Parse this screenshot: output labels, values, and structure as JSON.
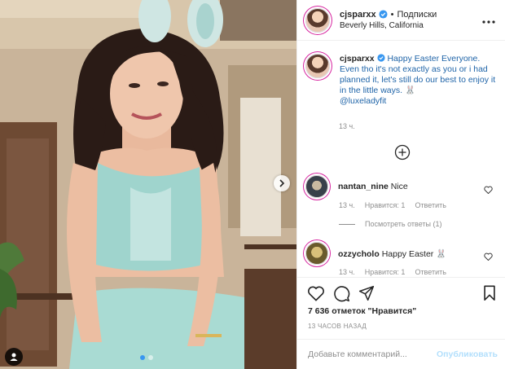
{
  "post": {
    "username": "cjsparxx",
    "separator": "•",
    "follow_label": "Подписки",
    "location": "Beverly Hills, California",
    "more_icon": "more-horizontal-icon",
    "carousel": {
      "total_slides": 2,
      "current_slide": 1
    }
  },
  "caption": {
    "username": "cjsparxx",
    "text": "Happy Easter Everyone. Even tho it's not exactly as you or i had planned it, let's still do our best to enjoy it in the little ways. 🐰",
    "mention": "@luxeladyfit",
    "time": "13 ч."
  },
  "comments": [
    {
      "username": "nantan_nine",
      "text": "Nice",
      "time": "13 ч.",
      "likes_label": "Нравится: 1",
      "reply_label": "Ответить"
    },
    {
      "username": "ozzycholo",
      "text": "Happy Easter 🐰",
      "time": "13 ч.",
      "likes_label": "Нравится: 1",
      "reply_label": "Ответить"
    }
  ],
  "view_replies": "Посмотреть ответы (1)",
  "likes_text": "7 636 отметок \"Нравится\"",
  "post_time": "13 ЧАСОВ НАЗАД",
  "comment_input": {
    "placeholder": "Добавьте комментарий...",
    "value": ""
  },
  "publish_label": "Опубликовать",
  "colors": {
    "verified": "#3897f0",
    "link": "#1f64a8",
    "muted": "#8e8e8e",
    "publish_disabled": "#b2dffc"
  }
}
